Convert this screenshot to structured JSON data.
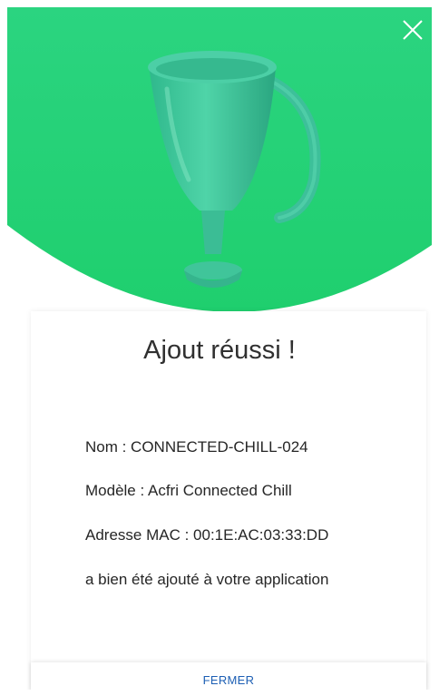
{
  "dialog": {
    "title": "Ajout réussi !",
    "device": {
      "name_line": "Nom : CONNECTED-CHILL-024",
      "model_line": "Modèle : Acfri Connected Chill",
      "mac_line": "Adresse MAC : 00:1E:AC:03:33:DD"
    },
    "confirmation": "a bien été ajouté à votre application",
    "close_button_label": "FERMER",
    "close_icon": "close-icon",
    "hero_icon": "trophy-icon"
  },
  "colors": {
    "hero_green": "#22d07a",
    "trophy": "#3ec49a",
    "button_text": "#1d5fb4"
  }
}
